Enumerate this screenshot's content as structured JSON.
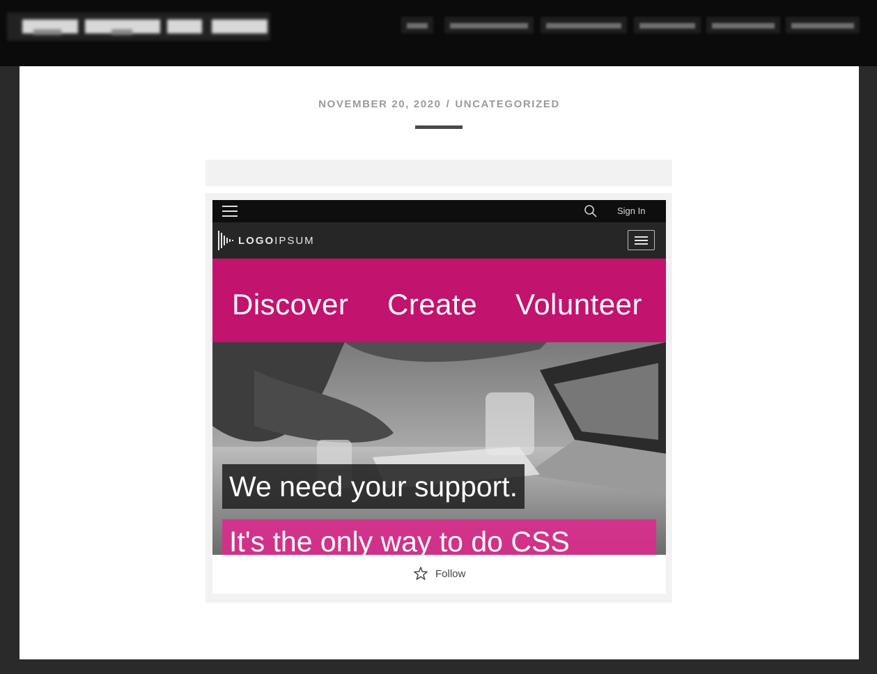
{
  "post": {
    "date": "NOVEMBER 20, 2020",
    "separator": "/",
    "category": "UNCATEGORIZED"
  },
  "embed": {
    "topbar": {
      "signin": "Sign In"
    },
    "brand": {
      "logo_bold": "LOGO",
      "logo_light": "IPSUM"
    },
    "nav_links": [
      "Discover",
      "Create",
      "Volunteer"
    ],
    "hero": {
      "line1": "We need your support.",
      "line2": "It's the only way to do CSS"
    },
    "follow": {
      "label": "Follow"
    }
  },
  "colors": {
    "accent_pink": "#c2136f",
    "hero_pink": "#db2b8c",
    "header_dark": "#0b0b0b"
  },
  "icons": {
    "menu": "hamburger-icon",
    "search": "search-icon",
    "follow": "star-icon",
    "logo": "soundwave-logo-icon"
  }
}
